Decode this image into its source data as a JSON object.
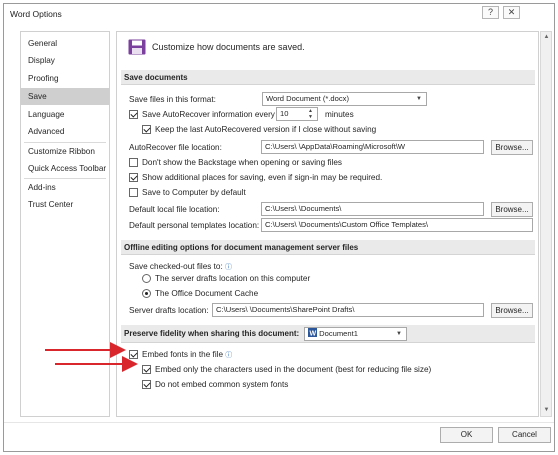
{
  "window": {
    "title": "Word Options",
    "help_glyph": "?",
    "close_glyph": "✕"
  },
  "sidebar": {
    "items": [
      {
        "label": "General"
      },
      {
        "label": "Display"
      },
      {
        "label": "Proofing"
      },
      {
        "label": "Save"
      },
      {
        "label": "Language"
      },
      {
        "label": "Advanced"
      },
      {
        "label": "Customize Ribbon"
      },
      {
        "label": "Quick Access Toolbar"
      },
      {
        "label": "Add-ins"
      },
      {
        "label": "Trust Center"
      }
    ]
  },
  "header": {
    "text": "Customize how documents are saved."
  },
  "save_documents": {
    "heading": "Save documents",
    "format_label": "Save files in this format:",
    "format_value": "Word Document (*.docx)",
    "autorecover_label": "Save AutoRecover information every",
    "autorecover_minutes": "10",
    "minutes_label": "minutes",
    "keep_last_label": "Keep the last AutoRecovered version if I close without saving",
    "autorecover_location_label": "AutoRecover file location:",
    "autorecover_location_value": "C:\\Users\\                              \\AppData\\Roaming\\Microsoft\\W",
    "browse": "Browse...",
    "backstage_label": "Don't show the Backstage when opening or saving files",
    "show_places_label": "Show additional places for saving, even if sign-in may be required.",
    "save_computer_label": "Save to Computer by default",
    "default_local_label": "Default local file location:",
    "default_local_value": "C:\\Users\\                              \\Documents\\",
    "templates_label": "Default personal templates location:",
    "templates_value": "C:\\Users\\                              \\Documents\\Custom Office Templates\\"
  },
  "offline": {
    "heading": "Offline editing options for document management server files",
    "checked_out_label": "Save checked-out files to:",
    "server_drafts_option": "The server drafts location on this computer",
    "office_cache_option": "The Office Document Cache",
    "server_drafts_location_label": "Server drafts location:",
    "server_drafts_location_value": "C:\\Users\\                              \\Documents\\SharePoint Drafts\\",
    "browse": "Browse..."
  },
  "fidelity": {
    "heading": "Preserve fidelity when sharing this document:",
    "document_value": "Document1",
    "embed_fonts_label": "Embed fonts in the file",
    "embed_only_label": "Embed only the characters used in the document (best for reducing file size)",
    "no_common_label": "Do not embed common system fonts"
  },
  "footer": {
    "ok": "OK",
    "cancel": "Cancel"
  },
  "colors": {
    "arrow": "#d9262c",
    "selected_nav": "#cfcfcf",
    "section_bg": "#eaeaea"
  }
}
